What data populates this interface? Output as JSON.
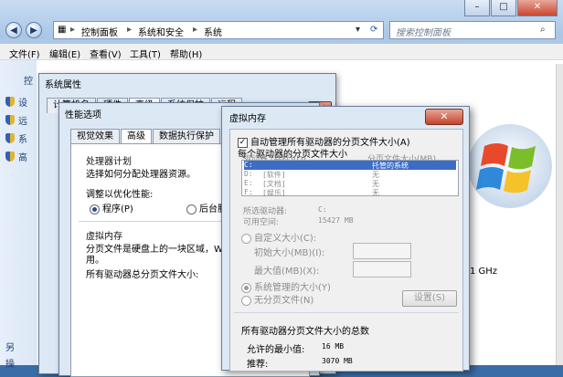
{
  "explorer": {
    "breadcrumb": [
      "控制面板",
      "系统和安全",
      "系统"
    ],
    "search_placeholder": "搜索控制面板",
    "menu": [
      "文件(F)",
      "编辑(E)",
      "查看(V)",
      "工具(T)",
      "帮助(H)"
    ],
    "left_pane_title": "控",
    "left_items": [
      "设",
      "远",
      "系",
      "高"
    ],
    "left_footer": [
      "另",
      "操"
    ],
    "right_fragment": "1 GHz"
  },
  "system_properties": {
    "title": "系统属性",
    "tabs": [
      "计算机名",
      "硬件",
      "高级",
      "系统保护",
      "远程"
    ]
  },
  "performance_options": {
    "title": "性能选项",
    "tabs": [
      "视觉效果",
      "高级",
      "数据执行保护"
    ],
    "processor_group": "处理器计划",
    "processor_desc": "选择如何分配处理器资源。",
    "adjust_label": "调整以优化性能:",
    "radio_programs": "程序(P)",
    "radio_background": "后台服务",
    "vm_group": "虚拟内存",
    "vm_desc_1": "分页文件是硬盘上的一块区域，Win",
    "vm_desc_2": "用。",
    "vm_total": "所有驱动器总分页文件大小:"
  },
  "virtual_memory": {
    "title": "虚拟内存",
    "close": "✕",
    "auto_manage": "自动管理所有驱动器的分页文件大小(A)",
    "per_drive": "每个驱动器的分页文件大小",
    "col_drive": "驱动器 [卷标](D)",
    "col_size": "分页文件大小(MB)",
    "drives": [
      {
        "drive": "C:",
        "label": "",
        "size": "托管的系统"
      },
      {
        "drive": "D:",
        "label": "[软件]",
        "size": "无"
      },
      {
        "drive": "E:",
        "label": "[文档]",
        "size": "无"
      },
      {
        "drive": "F:",
        "label": "[娱乐]",
        "size": "无"
      }
    ],
    "selected_drive_label": "所选驱动器:",
    "selected_drive_value": "C:",
    "free_space_label": "可用空间:",
    "free_space_value": "15427 MB",
    "custom_size": "自定义大小(C):",
    "initial_size": "初始大小(MB)(I):",
    "max_size": "最大值(MB)(X):",
    "system_managed": "系统管理的大小(Y)",
    "no_paging": "无分页文件(N)",
    "set_button": "设置(S)",
    "total_group": "所有驱动器分页文件大小的总数",
    "min_label": "允许的最小值:",
    "min_value": "16 MB",
    "recommended_label": "推荐:",
    "recommended_value": "3070 MB"
  }
}
